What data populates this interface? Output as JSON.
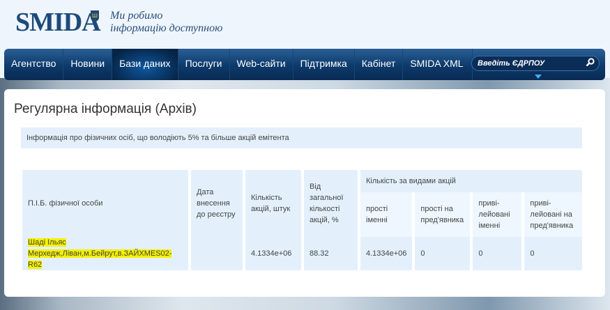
{
  "header": {
    "logo": "SMIDA",
    "slogan_line1": "Ми робимо",
    "slogan_line2": "інформацію доступною"
  },
  "nav": {
    "items": [
      "Агентство",
      "Новини",
      "Бази даних",
      "Послуги",
      "Web-сайти",
      "Підтримка",
      "Кабінет",
      "SMIDA XML"
    ],
    "active": "Бази даних",
    "search_placeholder": "Введіть ЄДРПОУ"
  },
  "page": {
    "title": "Регулярна інформація (Архів)",
    "info": "Інформація про фізичних осіб, що володіють 5% та більше акцій емітента"
  },
  "table": {
    "headers": {
      "name": "П.І.Б. фізичної особи",
      "date": "Дата внесення до реєстру",
      "count": "Кількість акцій, штук",
      "percent": "Від загальної кількості акцій, %",
      "by_type": "Кількість за видами акцій",
      "simple_named": "прості іменні",
      "simple_bearer": "прості на пред'явника",
      "pref_named": "приві-лейовані іменні",
      "pref_bearer": "приві-лейовані на пред'явника"
    },
    "rows": [
      {
        "name_line1": "Шаді Ільяс",
        "name_line2": "Мерхедж,Ліван,м.Бейрут,в.ЗАЙХМЕS02-R62",
        "date": "",
        "count": "4.1334e+06",
        "percent": "88.32",
        "simple_named": "4.1334e+06",
        "simple_bearer": "0",
        "pref_named": "0",
        "pref_bearer": "0"
      }
    ]
  },
  "colors": {
    "nav": "#0d3a6b",
    "cell": "#e3f0fc",
    "highlight": "#f4f000"
  }
}
